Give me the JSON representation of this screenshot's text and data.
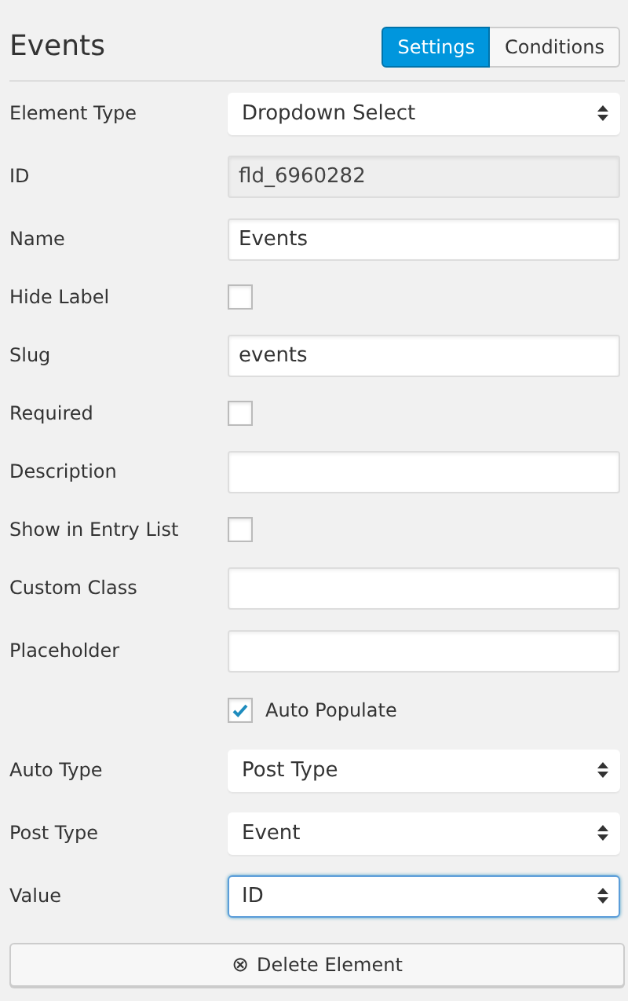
{
  "title": "Events",
  "tabs": [
    {
      "label": "Settings",
      "selected": true
    },
    {
      "label": "Conditions",
      "selected": false
    }
  ],
  "fields": [
    {
      "kind": "select",
      "label": "Element Type",
      "value": "Dropdown Select",
      "focused": false
    },
    {
      "kind": "readonly",
      "label": "ID",
      "value": "fld_6960282"
    },
    {
      "kind": "text",
      "label": "Name",
      "value": "Events"
    },
    {
      "kind": "checkbox",
      "label": "Hide Label",
      "checked": false
    },
    {
      "kind": "text",
      "label": "Slug",
      "value": "events"
    },
    {
      "kind": "checkbox",
      "label": "Required",
      "checked": false
    },
    {
      "kind": "text",
      "label": "Description"
    },
    {
      "kind": "checkbox",
      "label": "Show in Entry List",
      "checked": false
    },
    {
      "kind": "text",
      "label": "Custom Class"
    },
    {
      "kind": "text",
      "label": "Placeholder"
    },
    {
      "kind": "inline_checkbox",
      "label": "Auto Populate",
      "checked": true
    },
    {
      "kind": "select",
      "label": "Auto Type",
      "value": "Post Type",
      "focused": false
    },
    {
      "kind": "select",
      "label": "Post Type",
      "value": "Event",
      "focused": false
    },
    {
      "kind": "select",
      "label": "Value",
      "value": "ID",
      "focused": true
    }
  ],
  "delete_button": {
    "icon": "⊗",
    "label": "Delete Element"
  }
}
